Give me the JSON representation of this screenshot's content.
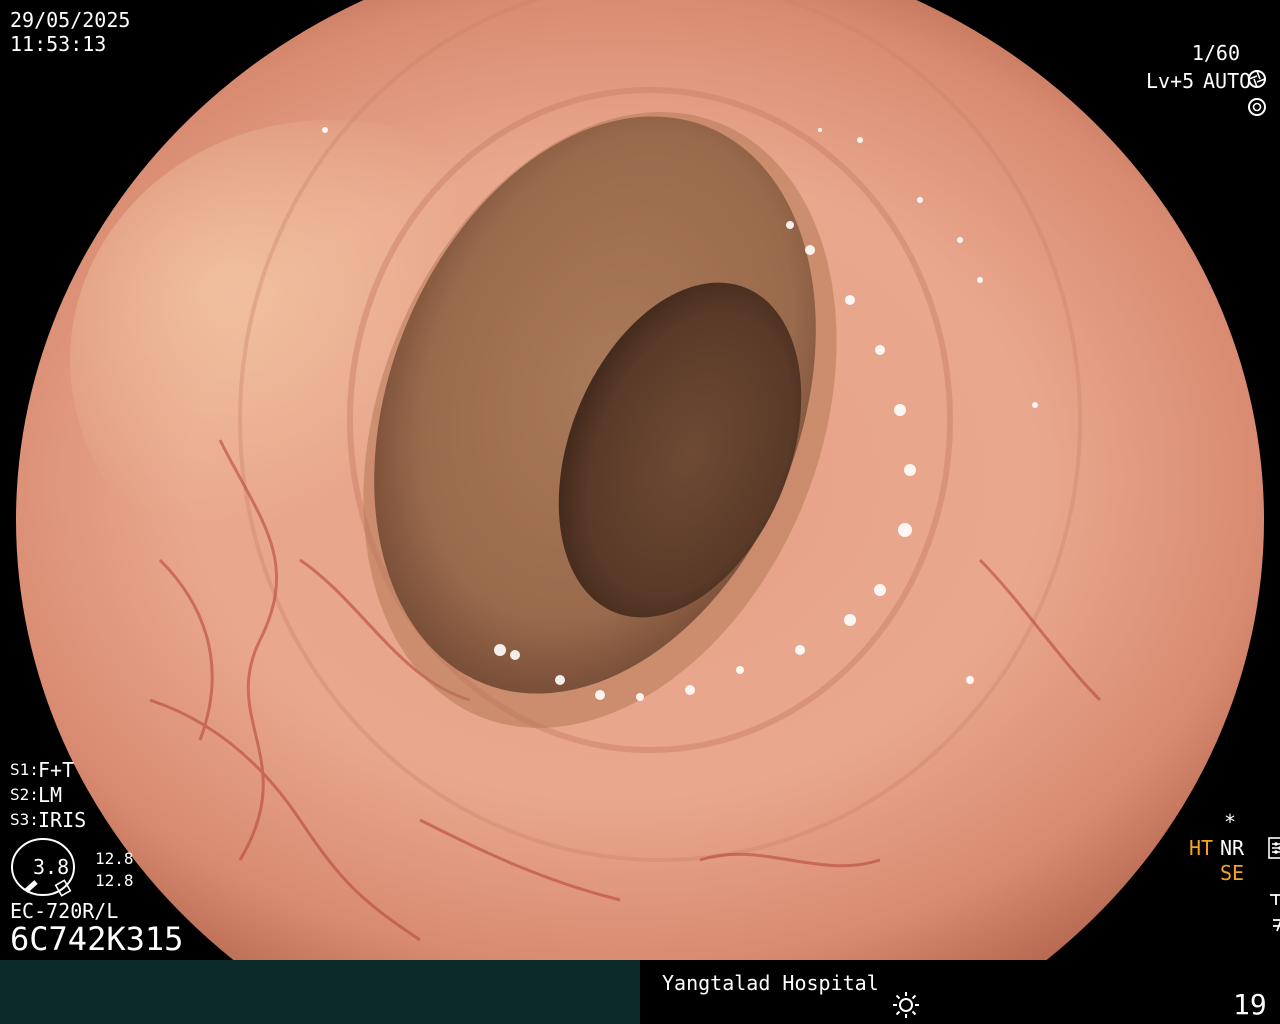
{
  "header": {
    "date": "29/05/2025",
    "time": "11:53:13"
  },
  "top_right": {
    "shutter": "1/60",
    "shutter_icon": "aperture-icon",
    "level": "Lv+5",
    "mode": "AUTO",
    "mode_icon": "iris-icon"
  },
  "settings": {
    "s1_key": "S1:",
    "s1_val": "F+T",
    "s2_key": "S2:",
    "s2_val": "LM",
    "s3_key": "S3:",
    "s3_val": "IRIS"
  },
  "scope_gauge": {
    "value": "3.8",
    "top_val": "12.8",
    "bottom_val": "12.8"
  },
  "scope": {
    "model": "EC-720R/L",
    "serial": "6C742K315"
  },
  "right_indicators": {
    "asterisk": "*",
    "ht": "HT",
    "nr": "NR",
    "se": "SE"
  },
  "footer": {
    "hospital": "Yangtalad Hospital",
    "light_icon": "sun-icon",
    "count": "19"
  },
  "colors": {
    "orange": "#f6a31f",
    "footer_left_bg": "#0c2a2a"
  }
}
